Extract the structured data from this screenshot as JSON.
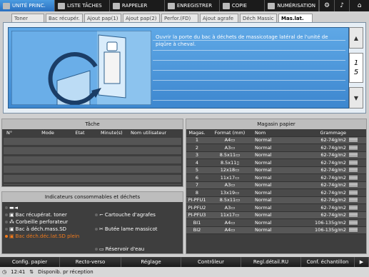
{
  "topnav": {
    "tabs": [
      {
        "label": "UNITÉ PRINC.",
        "icon": "printer-icon",
        "active": true
      },
      {
        "label": "LISTE TÂCHES",
        "icon": "list-icon",
        "active": false
      },
      {
        "label": "RAPPELER",
        "icon": "recall-icon",
        "active": false
      },
      {
        "label": "ENREGISTRER",
        "icon": "save-icon",
        "active": false
      },
      {
        "label": "COPIE",
        "icon": "copy-icon",
        "active": false
      },
      {
        "label": "NUMÉRISATION",
        "icon": "scan-icon",
        "active": false
      }
    ],
    "buttons": [
      {
        "icon": "settings-icon",
        "glyph": "⚙"
      },
      {
        "icon": "volume-icon",
        "glyph": "♪"
      },
      {
        "icon": "home-icon",
        "glyph": "⌂"
      }
    ]
  },
  "subtabs": [
    "Toner",
    "Bac récupér.",
    "Ajout pap(1)",
    "Ajout pap(2)",
    "Perfor.(FD)",
    "Ajout agrafe",
    "Déch Massic",
    "Mas.lat."
  ],
  "subtab_active": 7,
  "banner": {
    "message": "Ouvrir la porte du bac à déchets de massicotage latéral de l'unité de piqûre à cheval.",
    "page_current": "1",
    "page_total": "5",
    "up_glyph": "▲",
    "down_glyph": "▼"
  },
  "tache": {
    "title": "Tâche",
    "columns": [
      "N°",
      "Mode",
      "Etat",
      "Minute(s)",
      "Nom utilisateur"
    ]
  },
  "indicateurs": {
    "title": "Indicateurs consommables et déchets",
    "items": [
      {
        "label": "",
        "glyph": "▬◄",
        "alert": false
      },
      {
        "label": "Bac récupérat. toner",
        "glyph": "▣",
        "alert": false
      },
      {
        "label": "Corbeille perforateur",
        "glyph": "⁂",
        "alert": false
      },
      {
        "label": "Bac à déch.mass.SD",
        "glyph": "▣",
        "alert": false
      },
      {
        "label": "Bac déch.déc.lat.SD plein",
        "glyph": "▣",
        "alert": true
      },
      {
        "label": "Cartouche d'agrafes",
        "glyph": "⌐",
        "alert": false
      },
      {
        "label": "Butée lame massicot",
        "glyph": "✂",
        "alert": false
      },
      {
        "label": "Réservoir d'eau",
        "glyph": "▭",
        "alert": false
      }
    ]
  },
  "magasin": {
    "title": "Magasin papier",
    "columns": [
      "Magas.",
      "Format (mm)",
      "Nom",
      "Grammage"
    ],
    "rows": [
      [
        "1",
        "A4▭",
        "Normal",
        "62-74g/m2"
      ],
      [
        "2",
        "A3▭",
        "Normal",
        "62-74g/m2"
      ],
      [
        "3",
        "8.5x11▭",
        "Normal",
        "62-74g/m2"
      ],
      [
        "4",
        "8.5x11▯",
        "Normal",
        "62-74g/m2"
      ],
      [
        "5",
        "12x18▭",
        "Normal",
        "62-74g/m2"
      ],
      [
        "6",
        "11x17▭",
        "Normal",
        "62-74g/m2"
      ],
      [
        "7",
        "A3▭",
        "Normal",
        "62-74g/m2"
      ],
      [
        "8",
        "13x19▭",
        "Normal",
        "62-74g/m2"
      ],
      [
        "PI-PFU1",
        "8.5x11▭",
        "Normal",
        "62-74g/m2"
      ],
      [
        "PI-PFU2",
        "A3▭",
        "Normal",
        "62-74g/m2"
      ],
      [
        "PI-PFU3",
        "11x17▭",
        "Normal",
        "62-74g/m2"
      ],
      [
        "BI1",
        "A4▭",
        "Normal",
        "106-135g/m2"
      ],
      [
        "BI2",
        "A4▭",
        "Normal",
        "106-135g/m2"
      ]
    ]
  },
  "bottom": {
    "buttons": [
      "Config. papier",
      "Recto-verso",
      "Réglage",
      "Contrôleur",
      "Regl.détail.RU",
      "Conf. échantillon"
    ]
  },
  "status": {
    "time": "12:41",
    "text": "Disponib. pr réception"
  },
  "colors": {
    "active_tab": "#2a6fc0",
    "banner_blue": "#3d87cf",
    "alert_orange": "#f07a1c"
  }
}
